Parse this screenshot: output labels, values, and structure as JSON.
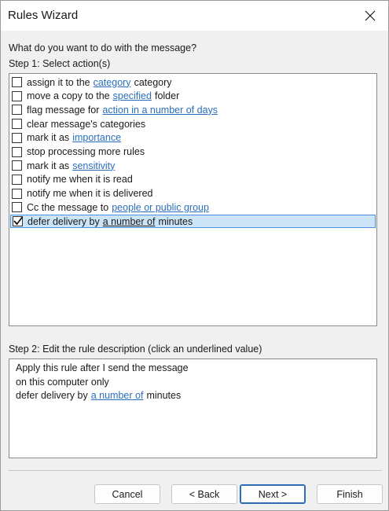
{
  "window": {
    "title": "Rules Wizard"
  },
  "prompt": {
    "question": "What do you want to do with the message?",
    "step1_label": "Step 1: Select action(s)"
  },
  "actions": [
    {
      "pre": "assign it to the",
      "link": "category",
      "post": "category",
      "checked": false,
      "selected": false
    },
    {
      "pre": "move a copy to the",
      "link": "specified",
      "post": "folder",
      "checked": false,
      "selected": false
    },
    {
      "pre": "flag message for",
      "link": "action in a number of days",
      "post": "",
      "checked": false,
      "selected": false
    },
    {
      "pre": "clear message's categories",
      "link": "",
      "post": "",
      "checked": false,
      "selected": false
    },
    {
      "pre": "mark it as",
      "link": "importance",
      "post": "",
      "checked": false,
      "selected": false
    },
    {
      "pre": "stop processing more rules",
      "link": "",
      "post": "",
      "checked": false,
      "selected": false
    },
    {
      "pre": "mark it as",
      "link": "sensitivity",
      "post": "",
      "checked": false,
      "selected": false
    },
    {
      "pre": "notify me when it is read",
      "link": "",
      "post": "",
      "checked": false,
      "selected": false
    },
    {
      "pre": "notify me when it is delivered",
      "link": "",
      "post": "",
      "checked": false,
      "selected": false
    },
    {
      "pre": "Cc the message to",
      "link": "people or public group",
      "post": "",
      "checked": false,
      "selected": false
    },
    {
      "pre": "defer delivery by",
      "link": "a number of",
      "post": "minutes",
      "checked": true,
      "selected": true
    }
  ],
  "description": {
    "step2_label": "Step 2: Edit the rule description (click an underlined value)",
    "line1": "Apply this rule after I send the message",
    "line2": "on this computer only",
    "line3_pre": "defer delivery by",
    "line3_link": "a number of",
    "line3_post": "minutes"
  },
  "buttons": {
    "cancel": "Cancel",
    "back": "< Back",
    "next": "Next >",
    "finish": "Finish"
  },
  "colors": {
    "link": "#2a6ebb",
    "selection_bg": "#cce4f7",
    "selection_border": "#4a90d9"
  }
}
